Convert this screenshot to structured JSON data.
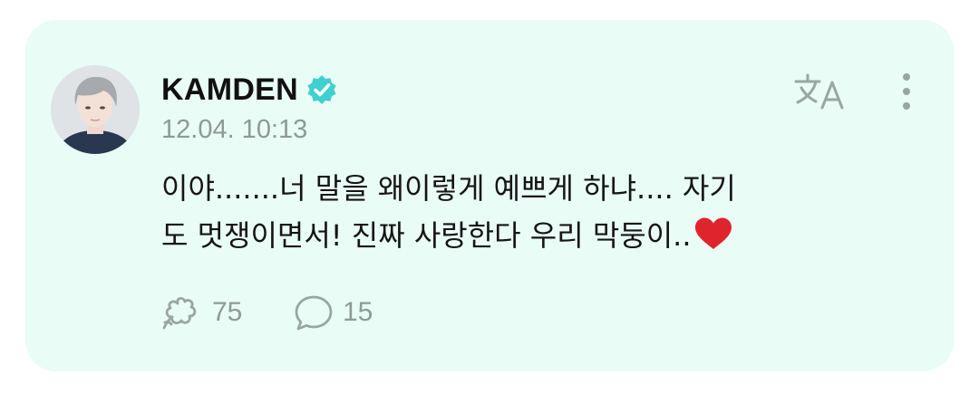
{
  "post": {
    "author": "KAMDEN",
    "timestamp": "12.04. 10:13",
    "body_lines": [
      "이야.......너 말을 왜이렇게 예쁘게 하냐.... 자기",
      "도 멋쟁이면서! 진짜 사랑한다 우리 막둥이.."
    ],
    "like_count": "75",
    "comment_count": "15"
  },
  "icons": {
    "verified": "verified-badge-icon",
    "translate": "translate-icon",
    "more": "more-vertical-icon",
    "like": "flower-like-icon",
    "comment": "comment-bubble-icon",
    "emoji": "red-heart-emoji"
  },
  "colors": {
    "card_background": "#e9fcf6",
    "verified_badge": "#3fd0cf",
    "muted_text": "#8e9a96",
    "heart": "#e0242d"
  }
}
